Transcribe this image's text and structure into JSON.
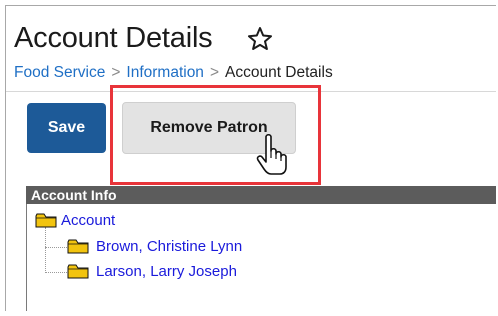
{
  "header": {
    "title": "Account Details"
  },
  "breadcrumb": {
    "items": [
      "Food Service",
      "Information"
    ],
    "current": "Account Details"
  },
  "toolbar": {
    "save_label": "Save",
    "remove_label": "Remove Patron"
  },
  "panel": {
    "heading": "Account Info",
    "root": "Account",
    "children": [
      "Brown, Christine Lynn",
      "Larson, Larry Joseph"
    ]
  },
  "colors": {
    "save_button": "#1d5a98",
    "highlight": "#e8343a",
    "link": "#1f6fc5",
    "tree_link": "#1a1adb",
    "folder": "#f2c40f"
  }
}
